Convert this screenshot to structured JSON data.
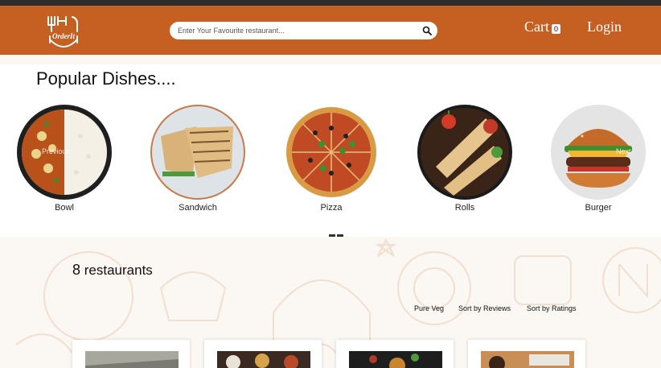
{
  "header": {
    "logo_text": "OrderIt",
    "search_placeholder": "Enter Your Favourite restaurant...",
    "cart_label": "Cart",
    "cart_count": "0",
    "login_label": "Login"
  },
  "popular": {
    "title": "Popular Dishes....",
    "prev_label": "Previous",
    "next_label": "Next",
    "dishes": [
      {
        "label": "Bowl"
      },
      {
        "label": "Sandwich"
      },
      {
        "label": "Pizza"
      },
      {
        "label": "Rolls"
      },
      {
        "label": "Burger"
      }
    ]
  },
  "restaurants": {
    "count": "8",
    "count_label": "restaurants",
    "filters": [
      "Pure Veg",
      "Sort by Reviews",
      "Sort by Ratings"
    ]
  },
  "colors": {
    "header": "#c65f22",
    "pattern": "#f1dfcf"
  }
}
